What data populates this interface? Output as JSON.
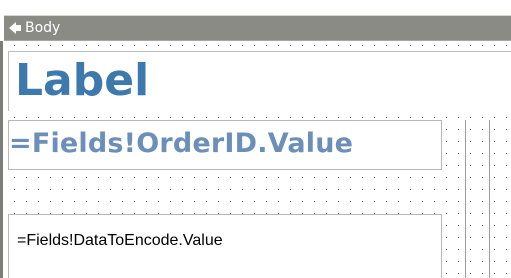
{
  "section": {
    "title": "Body",
    "icon": "collapse-arrow-icon"
  },
  "items": {
    "label": "Label",
    "order_id_expression": "=Fields!OrderID.Value",
    "encode_expression": "=Fields!DataToEncode.Value"
  },
  "colors": {
    "header_bg": "#8b8b86",
    "label_text": "#3d79ad",
    "order_id_text": "#6b8fb9",
    "item_border": "#b8b8b8"
  }
}
